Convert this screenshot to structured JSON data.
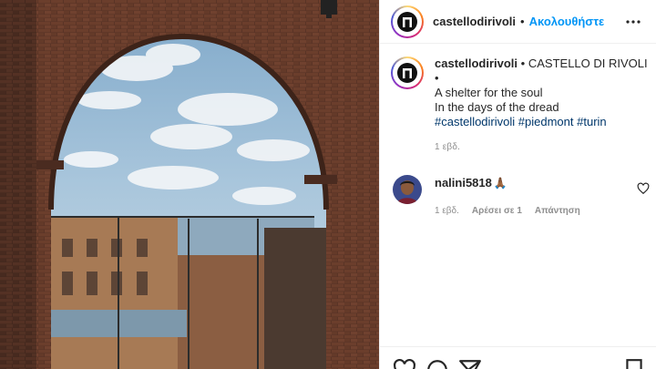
{
  "post": {
    "username": "castellodirivoli",
    "header_separator": "•",
    "follow_label": "Ακολουθήστε"
  },
  "caption": {
    "username": "castellodirivoli",
    "separator": "•",
    "location": "CASTELLO DI RIVOLI",
    "trailing_dot": "•",
    "lines": [
      "A shelter for the soul",
      "In the days of the dread"
    ],
    "hashtags": [
      "#castellodirivoli",
      "#piedmont",
      "#turin"
    ],
    "time": "1 εβδ."
  },
  "comment": {
    "username": "nalini5818",
    "emoji": "🙏🏾",
    "time": "1 εβδ.",
    "likes_label": "Αρέσει σε 1",
    "reply_label": "Απάντηση"
  },
  "icons": {
    "more": "more-horizontal-icon",
    "like": "heart-icon",
    "comment": "comment-icon",
    "share": "paper-plane-icon",
    "save": "bookmark-icon"
  },
  "colors": {
    "link": "#0095f6",
    "hashtag": "#00376b",
    "muted": "#8e8e8e",
    "text": "#262626"
  }
}
